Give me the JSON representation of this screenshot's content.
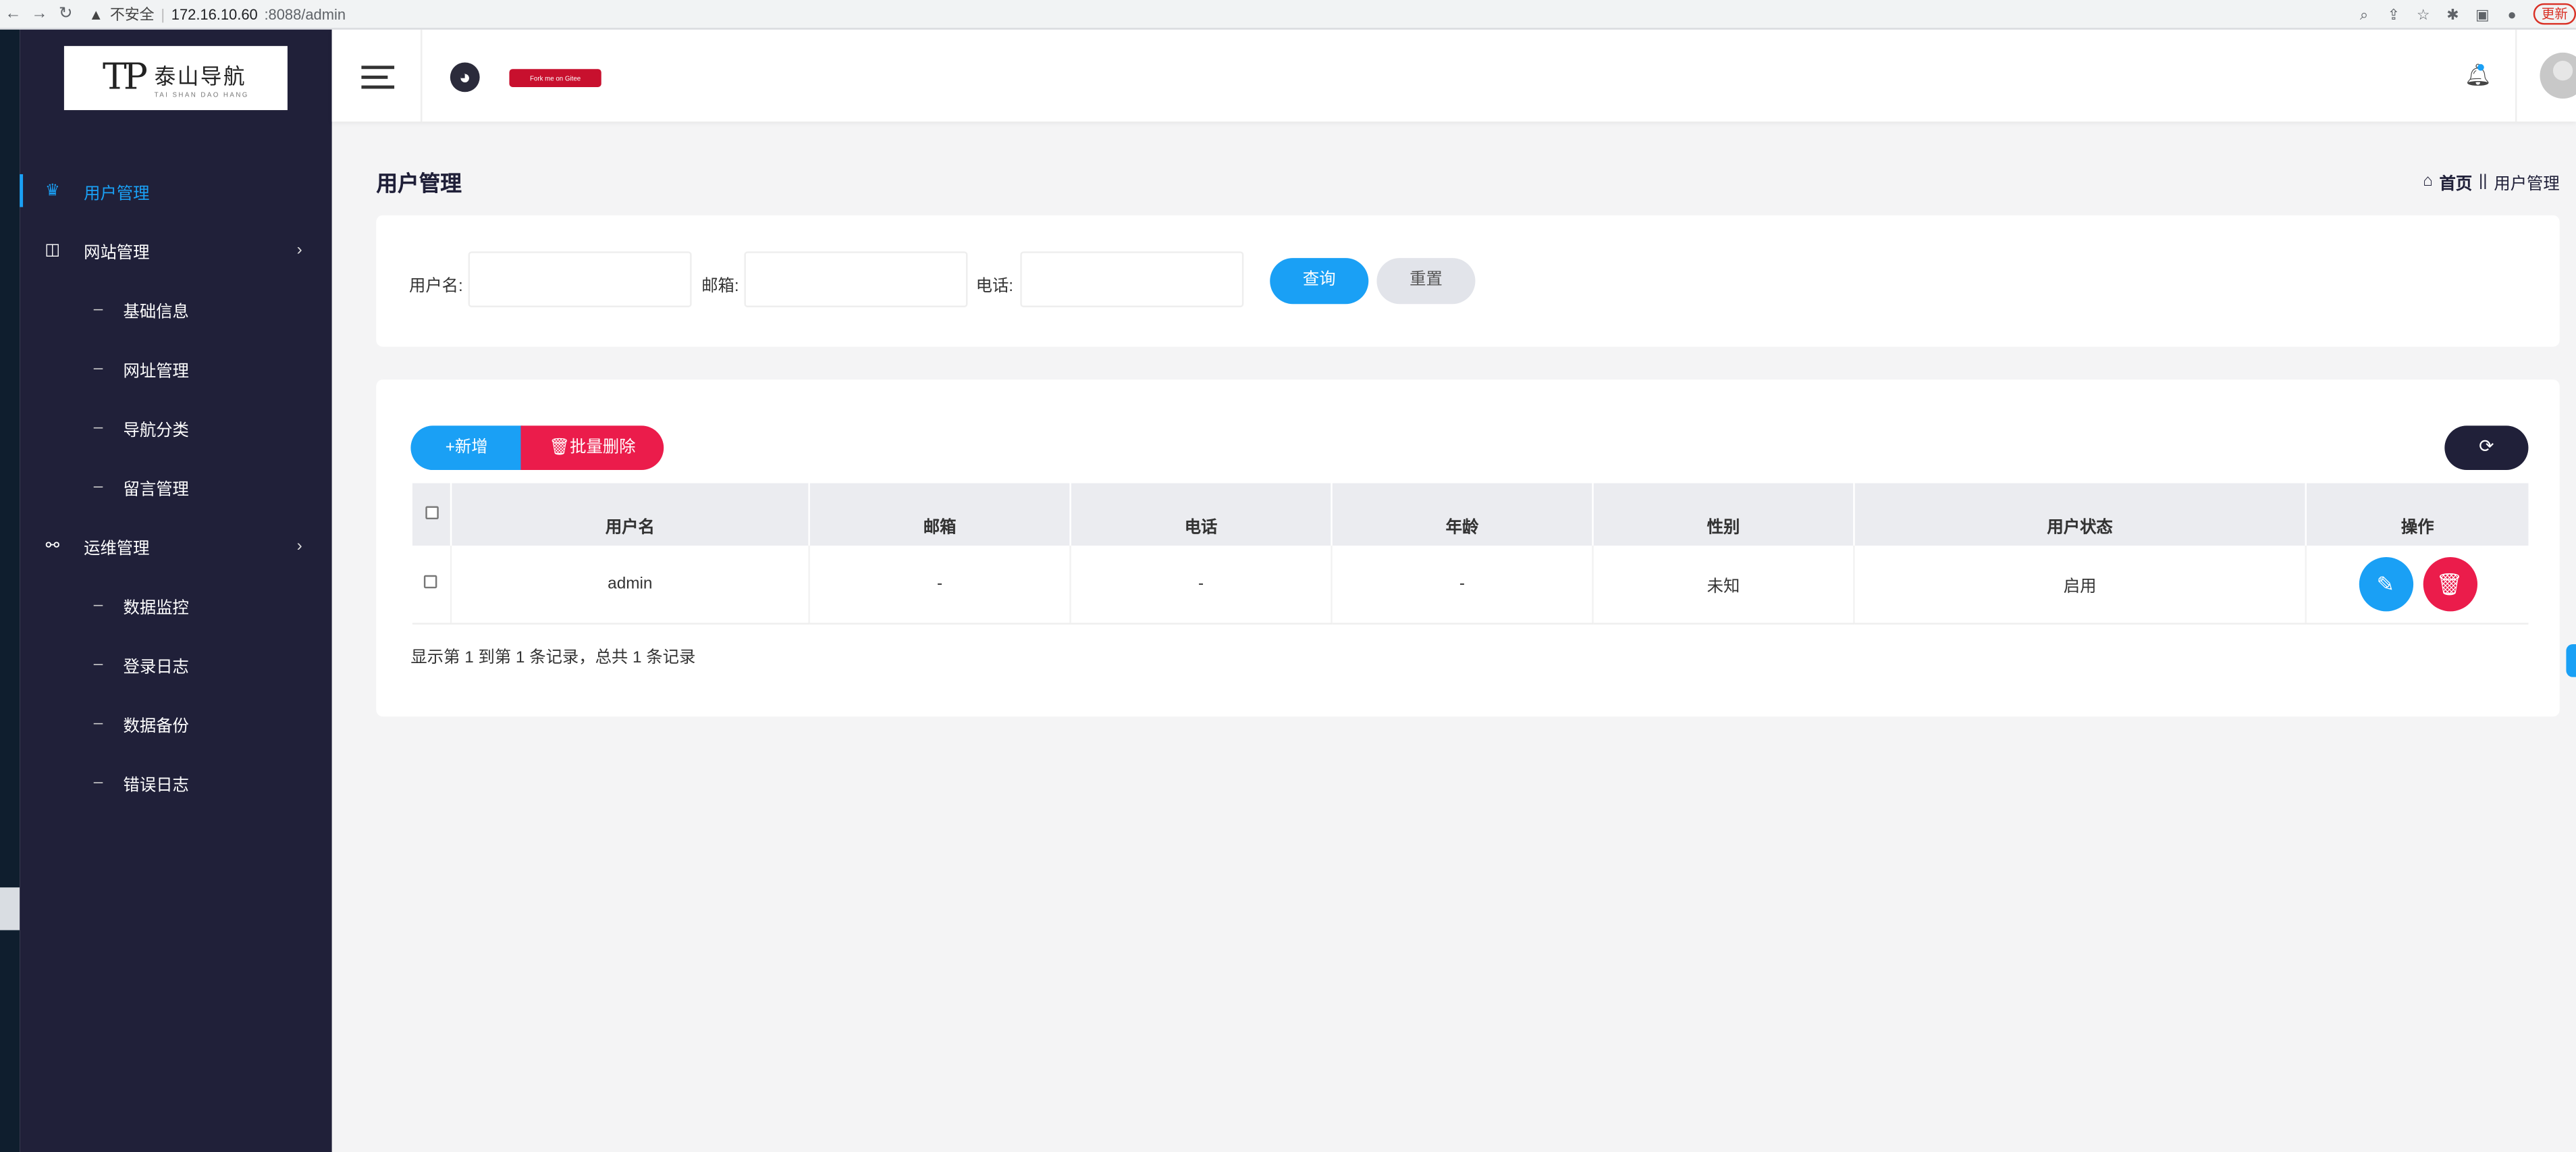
{
  "browser": {
    "security": "不安全",
    "url_host": "172.16.10.60",
    "url_rest": ":8088/admin",
    "update": "更新"
  },
  "logo": {
    "text": "泰山导航",
    "sub": "TAI SHAN DAO HANG",
    "mark": "TP"
  },
  "sidebar": {
    "items": [
      {
        "label": "用户管理",
        "icon": "crown-icon",
        "active": true
      },
      {
        "label": "网站管理",
        "icon": "columns-icon"
      },
      {
        "label": "基础信息"
      },
      {
        "label": "网址管理"
      },
      {
        "label": "导航分类"
      },
      {
        "label": "留言管理"
      },
      {
        "label": "运维管理",
        "icon": "binoculars-icon"
      },
      {
        "label": "数据监控"
      },
      {
        "label": "登录日志"
      },
      {
        "label": "数据备份"
      },
      {
        "label": "错误日志"
      }
    ]
  },
  "header": {
    "flag_text": "Fork me on Gitee",
    "flag_badge": "G"
  },
  "page": {
    "title": "用户管理",
    "breadcrumb_home": "首页",
    "breadcrumb_sep": "||",
    "breadcrumb_current": "用户管理"
  },
  "search": {
    "username_label": "用户名:",
    "email_label": "邮箱:",
    "phone_label": "电话:",
    "query_btn": "查询",
    "reset_btn": "重置"
  },
  "toolbar": {
    "add": "+新增",
    "batch_delete": "批量删除"
  },
  "table": {
    "headers": [
      "用户名",
      "邮箱",
      "电话",
      "年龄",
      "性别",
      "用户状态",
      "操作"
    ],
    "rows": [
      {
        "username": "admin",
        "email": "-",
        "phone": "-",
        "age": "-",
        "gender": "未知",
        "status": "启用"
      }
    ]
  },
  "pager": {
    "text": "显示第 1 到第 1 条记录，总共 1 条记录"
  },
  "colors": {
    "accent": "#1aa0f5",
    "danger": "#eb1c4b",
    "sidebar": "#202039"
  }
}
